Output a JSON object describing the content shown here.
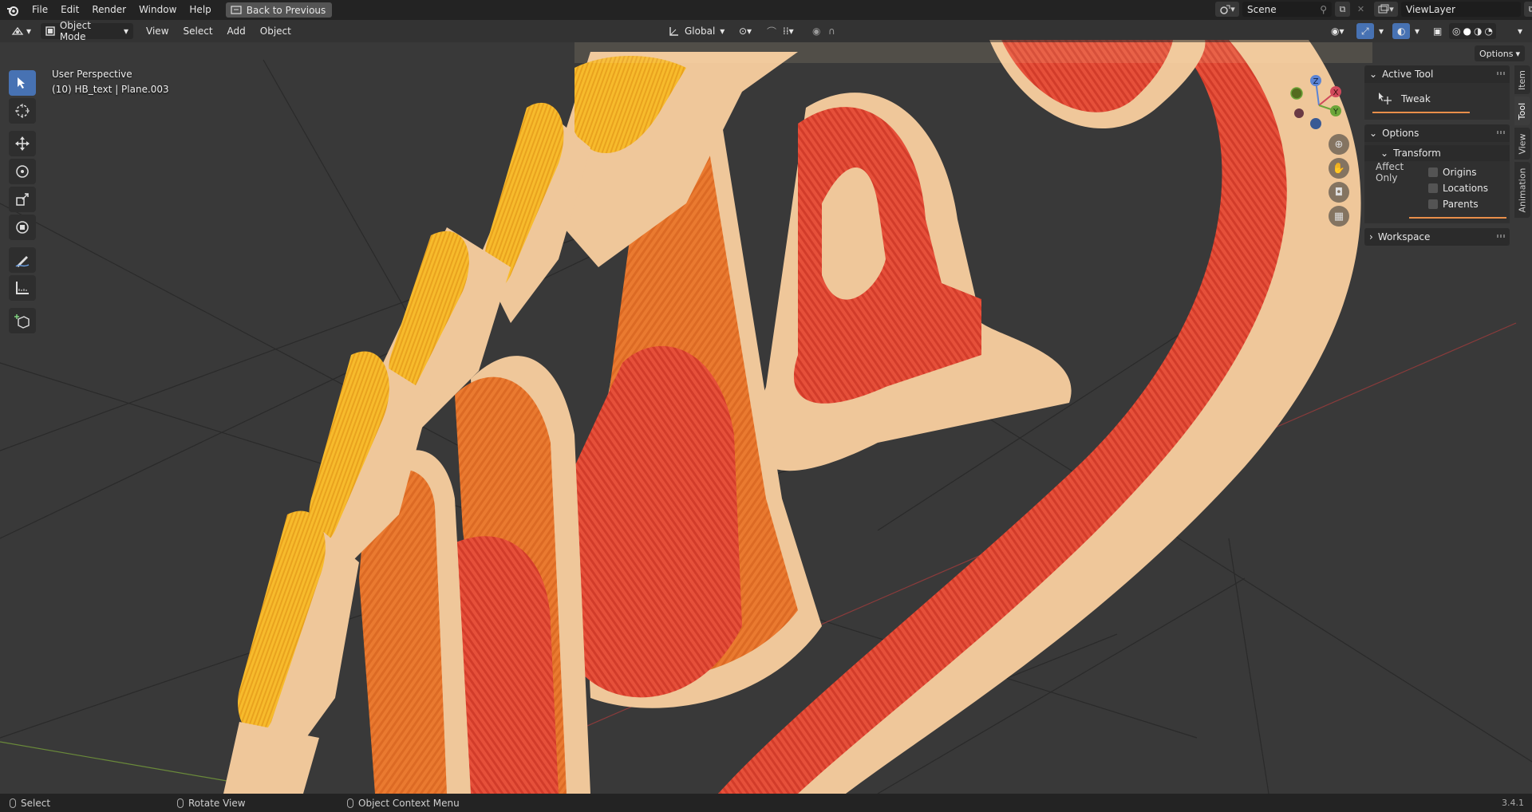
{
  "topbar": {
    "menu": [
      "File",
      "Edit",
      "Render",
      "Window",
      "Help"
    ],
    "back_button": "Back to Previous",
    "scene": "Scene",
    "view_layer": "ViewLayer"
  },
  "header": {
    "mode": "Object Mode",
    "menus": [
      "View",
      "Select",
      "Add",
      "Object"
    ],
    "orientation": "Global",
    "options": "Options"
  },
  "overlay": {
    "view_name": "User Perspective",
    "object_info": "(10) HB_text | Plane.003"
  },
  "gizmo": {
    "z": "Z",
    "x": "X",
    "y": "Y"
  },
  "npanel": {
    "active_tool_title": "Active Tool",
    "tool_name": "Tweak",
    "options_title": "Options",
    "transform_title": "Transform",
    "affect_only": "Affect Only",
    "checkboxes": [
      "Origins",
      "Locations",
      "Parents"
    ],
    "workspace_title": "Workspace"
  },
  "sidebar_tabs": [
    "Item",
    "Tool",
    "View",
    "Animation"
  ],
  "statusbar": {
    "select": "Select",
    "rotate": "Rotate View",
    "context_menu": "Object Context Menu",
    "version": "3.4.1"
  },
  "colors": {
    "accent": "#4772b3",
    "orange_letters": "#e9742e",
    "red_letters": "#e0462f",
    "yellow_letters": "#f4b22a",
    "bevel": "#efc79a"
  },
  "icons": {
    "blender_logo": "blender-logo-icon",
    "select_tool": "select-box-icon",
    "cursor_tool": "cursor-icon",
    "move_tool": "move-icon",
    "rotate_tool": "rotate-icon",
    "scale_tool": "scale-icon",
    "transform_tool": "transform-icon",
    "annotate_tool": "annotate-icon",
    "measure_tool": "measure-icon",
    "add_cube_tool": "add-cube-icon"
  }
}
